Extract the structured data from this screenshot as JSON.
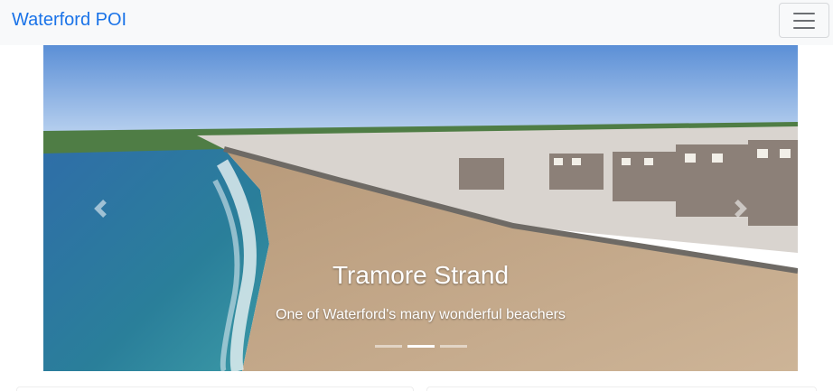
{
  "navbar": {
    "brand": "Waterford POI",
    "toggle_icon": "hamburger-menu-icon"
  },
  "carousel": {
    "slides": [
      {
        "title": "Tramore Strand",
        "subtitle": "One of Waterford's many wonderful beachers"
      }
    ],
    "active_index": 1,
    "indicator_count": 3,
    "prev_icon": "chevron-left-icon",
    "next_icon": "chevron-right-icon"
  }
}
